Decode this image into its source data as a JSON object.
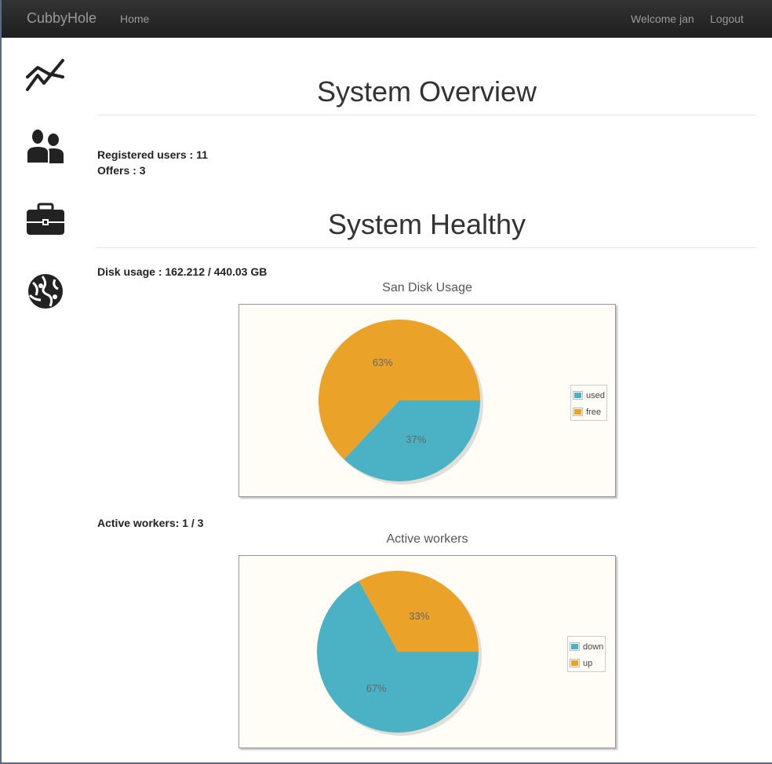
{
  "navbar": {
    "brand": "CubbyHole",
    "home": "Home",
    "welcome": "Welcome jan",
    "logout": "Logout"
  },
  "sidebar": {
    "items": [
      {
        "icon": "line-chart-icon"
      },
      {
        "icon": "users-icon"
      },
      {
        "icon": "briefcase-icon"
      },
      {
        "icon": "globe-icon"
      }
    ]
  },
  "overview": {
    "title": "System Overview",
    "registered_label": "Registered users : ",
    "registered_value": "11",
    "offers_label": "Offers : ",
    "offers_value": "3"
  },
  "health": {
    "title": "System Healthy",
    "disk_label": "Disk usage : ",
    "disk_value": "162.212 / 440.03 GB",
    "workers_label": "Active workers: ",
    "workers_value": "1 / 3"
  },
  "colors": {
    "used": "#4bb2c5",
    "free": "#eaa228",
    "plot_bg": "#fffdf6"
  },
  "chart_data": [
    {
      "type": "pie",
      "title": "San Disk Usage",
      "slices": [
        {
          "name": "used",
          "value": 37,
          "label": "37%",
          "color": "#4bb2c5"
        },
        {
          "name": "free",
          "value": 63,
          "label": "63%",
          "color": "#eaa228"
        }
      ],
      "legend_position": "right"
    },
    {
      "type": "pie",
      "title": "Active workers",
      "slices": [
        {
          "name": "down",
          "value": 67,
          "label": "67%",
          "color": "#4bb2c5"
        },
        {
          "name": "up",
          "value": 33,
          "label": "33%",
          "color": "#eaa228"
        }
      ],
      "legend_position": "right"
    }
  ]
}
